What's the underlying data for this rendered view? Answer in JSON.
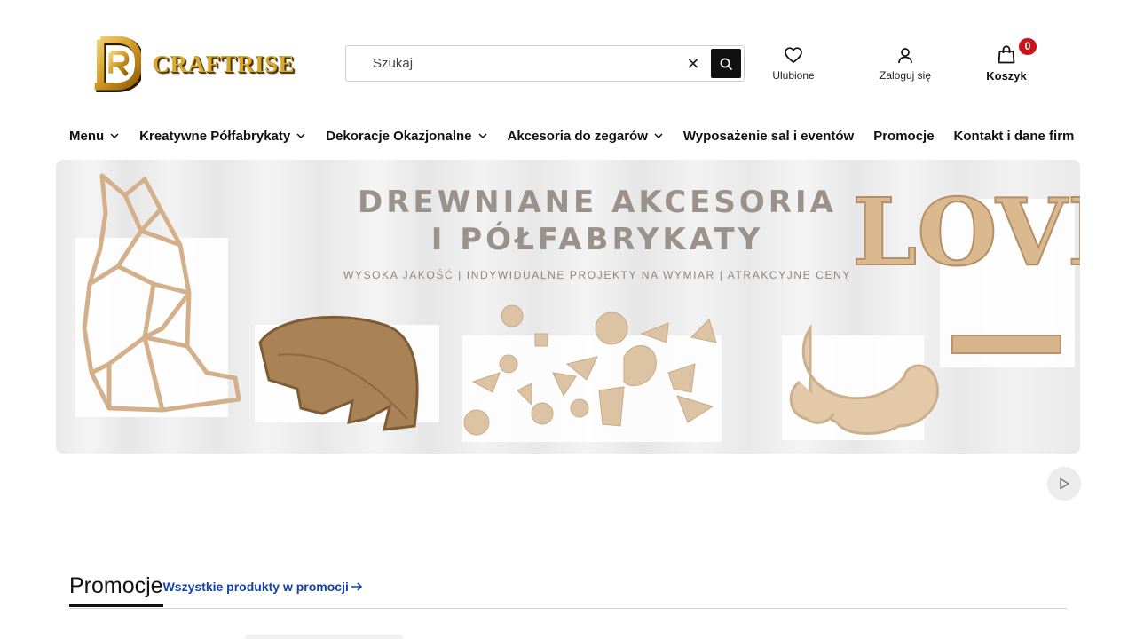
{
  "brand": {
    "name": "CRAFTRISE",
    "logo_letters": "DR"
  },
  "search": {
    "placeholder": "Szukaj",
    "value": ""
  },
  "header_actions": {
    "favorites_label": "Ulubione",
    "login_label": "Zaloguj się",
    "cart_label": "Koszyk",
    "cart_count": "0"
  },
  "nav": {
    "items": [
      {
        "label": "Menu",
        "has_dropdown": true
      },
      {
        "label": "Kreatywne Półfabrykaty",
        "has_dropdown": true
      },
      {
        "label": "Dekoracje Okazjonalne",
        "has_dropdown": true
      },
      {
        "label": "Akcesoria do zegarów",
        "has_dropdown": true
      },
      {
        "label": "Wyposażenie sal i eventów",
        "has_dropdown": false
      },
      {
        "label": "Promocje",
        "has_dropdown": false
      },
      {
        "label": "Kontakt i dane firm",
        "has_dropdown": false
      }
    ]
  },
  "banner": {
    "title_line1": "DREWNIANE AKCESORIA",
    "title_line2": "I PÓŁFABRYKATY",
    "subtitle": "WYSOKA JAKOŚĆ | INDYWIDUALNE PROJEKTY NA WYMIAR | ATRAKCYJNE CENY",
    "love_text": "LOVE"
  },
  "promotions": {
    "title": "Promocje",
    "all_link": "Wszystkie produkty w promocji"
  },
  "colors": {
    "brand_gold": "#d9a830",
    "badge_red": "#c9141a",
    "link_blue": "#1440a8",
    "wood": "#d9b894"
  },
  "icons": [
    "search-icon",
    "close-icon",
    "heart-icon",
    "user-icon",
    "bag-icon",
    "chevron-down-icon",
    "play-icon",
    "arrow-right-icon"
  ]
}
